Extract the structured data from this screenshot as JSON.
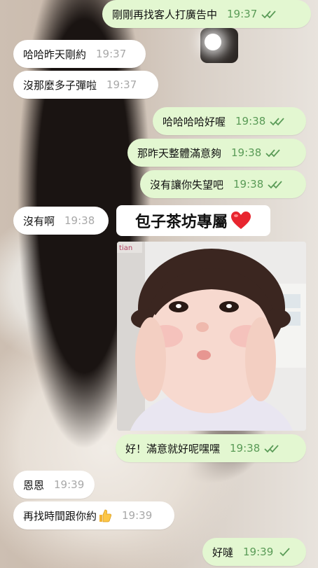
{
  "messages": [
    {
      "text": "剛剛再找客人打廣告中",
      "time": "19:37",
      "side": "out",
      "read": true
    },
    {
      "text": "哈哈昨天剛約",
      "time": "19:37",
      "side": "in"
    },
    {
      "text": "沒那麼多子彈啦",
      "time": "19:37",
      "side": "in"
    },
    {
      "text": "哈哈哈哈好喔",
      "time": "19:38",
      "side": "out",
      "read": true
    },
    {
      "text": "那昨天整體滿意夠",
      "time": "19:38",
      "side": "out",
      "read": true
    },
    {
      "text": "沒有讓你失望吧",
      "time": "19:38",
      "side": "out",
      "read": true
    },
    {
      "text": "沒有啊",
      "time": "19:38",
      "side": "in"
    },
    {
      "text": "好！滿意就好呢嘿嘿",
      "time": "19:38",
      "side": "out",
      "read": true
    },
    {
      "text": "恩恩",
      "time": "19:39",
      "side": "in"
    },
    {
      "text": "再找時間跟你約",
      "time": "19:39",
      "side": "in",
      "emoji": "thumbs-up"
    },
    {
      "text": "好噠",
      "time": "19:39",
      "side": "out",
      "read": false
    }
  ],
  "sticker": {
    "text": "包子茶坊專屬",
    "icon": "heart-icon"
  },
  "photo": {
    "corner_text": "tian"
  },
  "colors": {
    "outgoing_bubble": "#e3f7d1",
    "incoming_bubble": "#ffffff",
    "check_green": "#5a9b57"
  }
}
